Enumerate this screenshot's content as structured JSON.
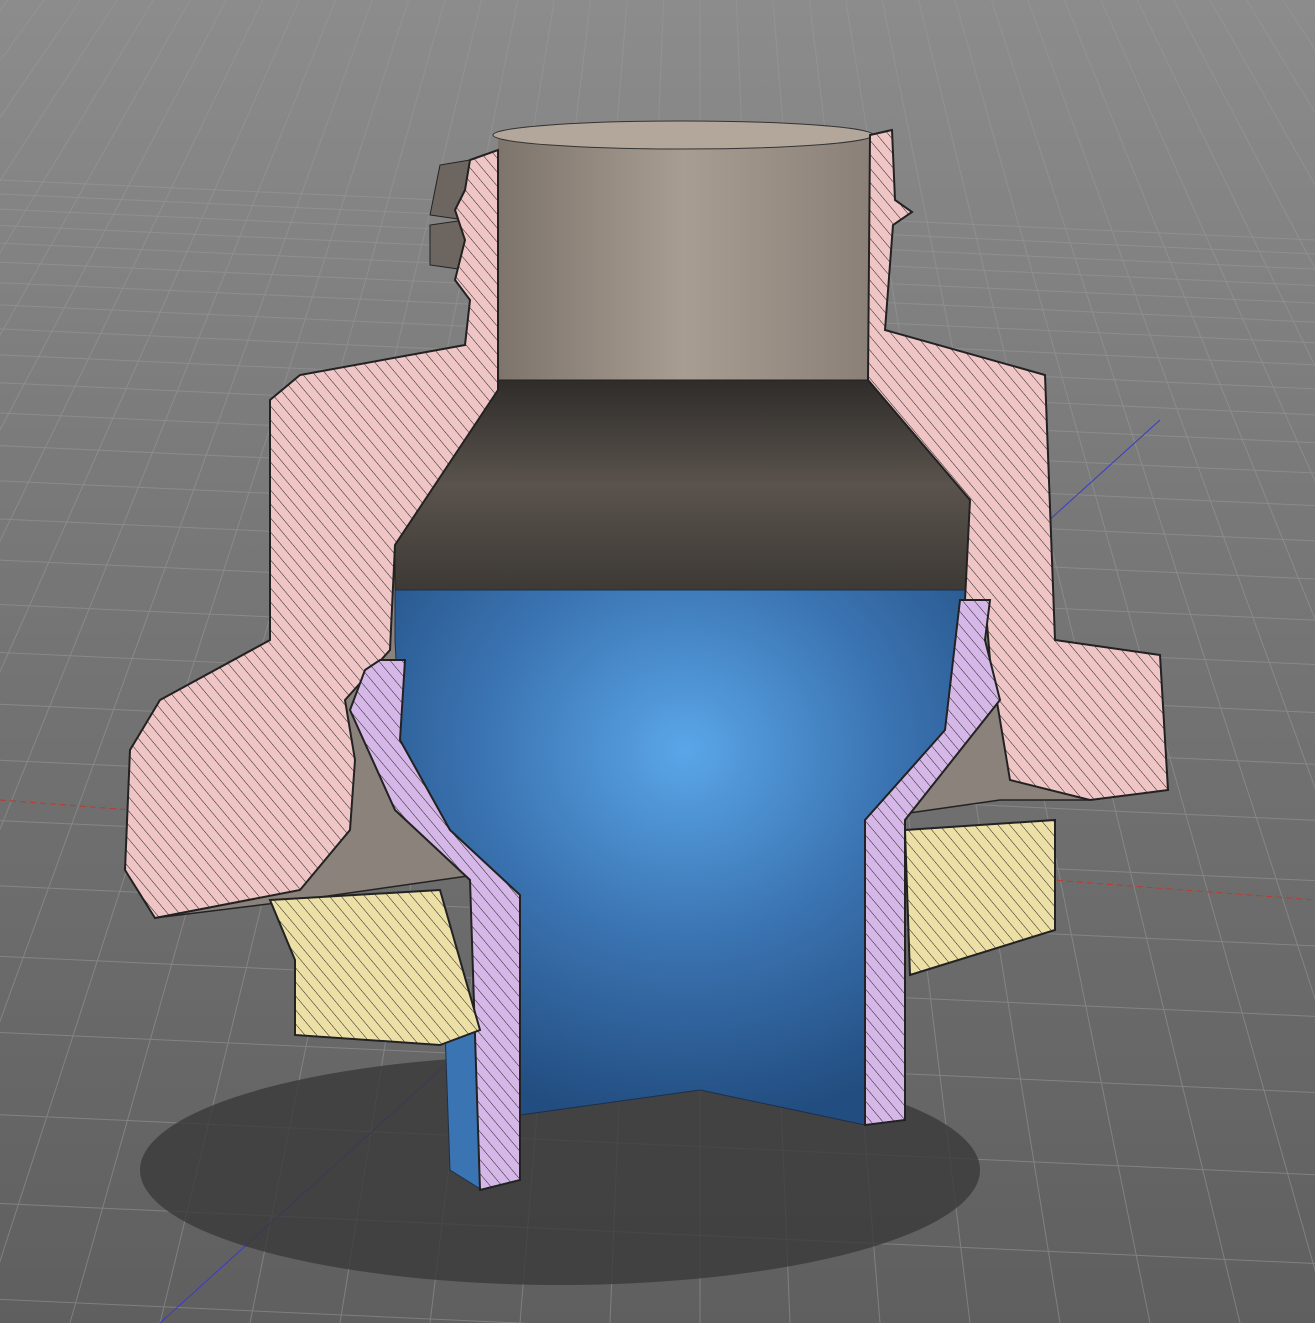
{
  "viewport": {
    "view_mode": "section-analysis",
    "colors": {
      "background_top": "#8c8c8c",
      "background_bottom": "#5f5f5f",
      "grid_line": "#9a9a9a",
      "x_axis": "#c0392b",
      "z_axis": "#3b3bc8",
      "section_body_1": "#efc5c5",
      "section_body_2": "#d6b8e8",
      "section_body_3": "#ece0a6",
      "body_surface": "#8f867e",
      "inner_surface": "#3c76b4",
      "shadow": "#3a3a3a"
    }
  }
}
